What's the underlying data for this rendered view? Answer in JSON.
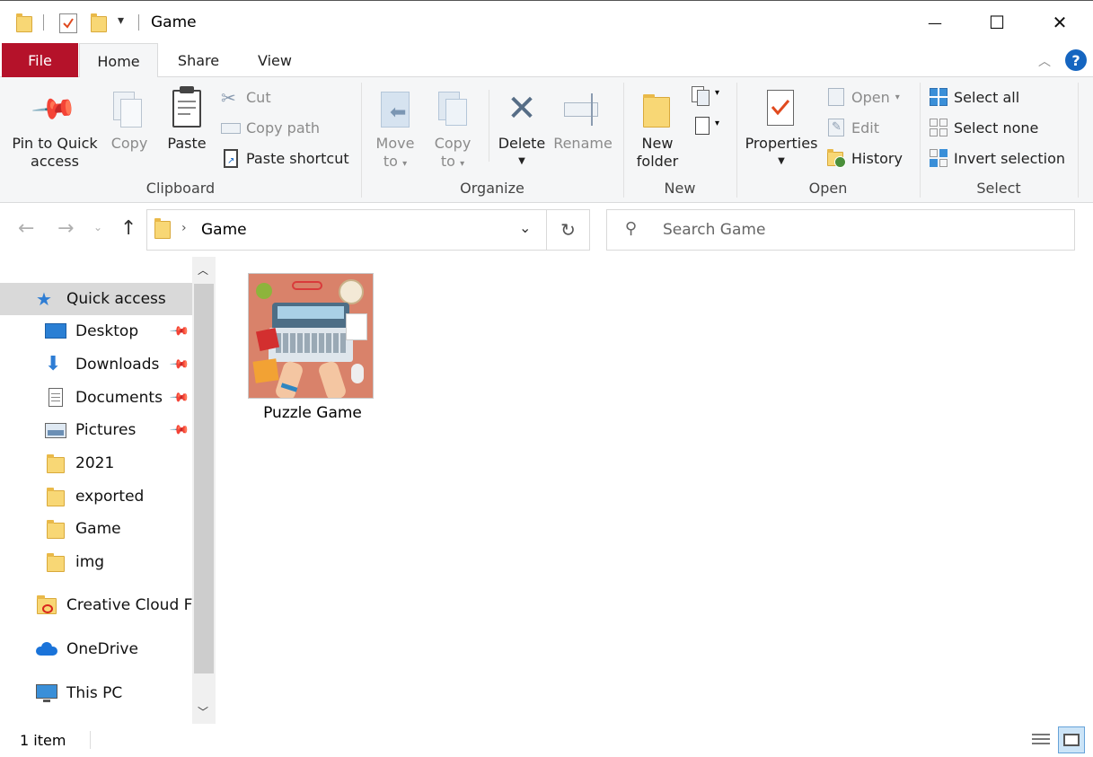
{
  "window": {
    "title": "Game",
    "qat_dropdown": "▾",
    "minimize": "—",
    "maximize": "☐",
    "close": "✕"
  },
  "tabs": [
    {
      "label": "File"
    },
    {
      "label": "Home"
    },
    {
      "label": "Share"
    },
    {
      "label": "View"
    }
  ],
  "ribbon": {
    "clipboard": {
      "label": "Clipboard",
      "pin_line1": "Pin to Quick",
      "pin_line2": "access",
      "copy": "Copy",
      "paste": "Paste",
      "cut": "Cut",
      "copy_path": "Copy path",
      "paste_shortcut": "Paste shortcut"
    },
    "organize": {
      "label": "Organize",
      "move_line1": "Move",
      "move_line2": "to",
      "copy_line1": "Copy",
      "copy_line2": "to",
      "delete": "Delete",
      "rename": "Rename"
    },
    "new": {
      "label": "New",
      "new_folder_line1": "New",
      "new_folder_line2": "folder"
    },
    "open": {
      "label": "Open",
      "properties": "Properties",
      "open": "Open",
      "edit": "Edit",
      "history": "History"
    },
    "select": {
      "label": "Select",
      "select_all": "Select all",
      "select_none": "Select none",
      "invert": "Invert selection"
    }
  },
  "address": {
    "path": "Game",
    "search_placeholder": "Search Game"
  },
  "nav": {
    "quick_access": "Quick access",
    "items": [
      {
        "label": "Desktop",
        "pinned": true
      },
      {
        "label": "Downloads",
        "pinned": true
      },
      {
        "label": "Documents",
        "pinned": true
      },
      {
        "label": "Pictures",
        "pinned": true
      },
      {
        "label": "2021",
        "pinned": false
      },
      {
        "label": "exported",
        "pinned": false
      },
      {
        "label": "Game",
        "pinned": false
      },
      {
        "label": "img",
        "pinned": false
      }
    ],
    "creative_cloud": "Creative Cloud Fil",
    "onedrive": "OneDrive",
    "this_pc": "This PC"
  },
  "content": {
    "files": [
      {
        "name": "Puzzle Game"
      }
    ]
  },
  "status": {
    "count": "1 item"
  },
  "colors": {
    "file_tab": "#b5122a",
    "help": "#1565c0",
    "folder": "#f8d775",
    "accent_blue": "#3a8fd8"
  }
}
